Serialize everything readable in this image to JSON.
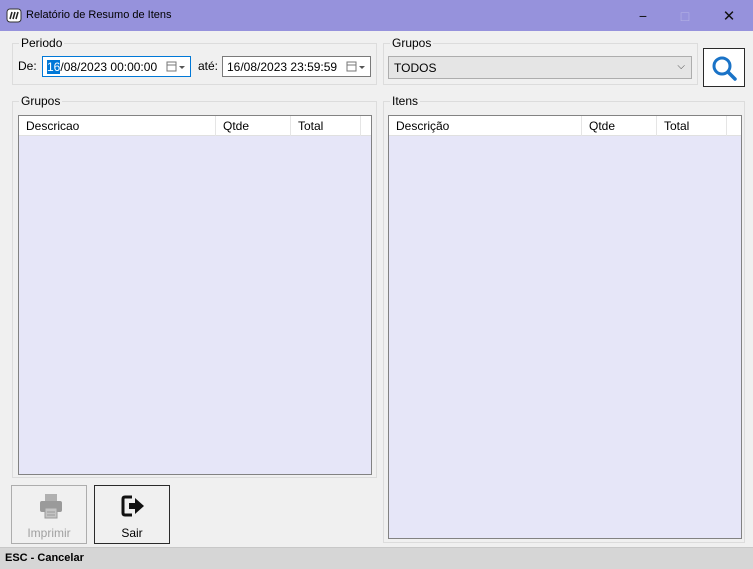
{
  "window": {
    "title": "Relatório de Resumo de Itens",
    "minimize_glyph": "−",
    "maximize_glyph": "□",
    "close_glyph": "✕",
    "titlebar_color": "#9692dc"
  },
  "periodo": {
    "legend": "Periodo",
    "de_label": "De:",
    "de_value_selected": "16",
    "de_value_rest": "/08/2023 00:00:00",
    "ate_label": "até:",
    "ate_value": "16/08/2023 23:59:59"
  },
  "grupos_filter": {
    "legend": "Grupos",
    "selected": "TODOS",
    "dropdown_glyph": "⌵"
  },
  "grupos_list": {
    "legend": "Grupos",
    "columns": [
      "Descricao",
      "Qtde",
      "Total"
    ],
    "rows": []
  },
  "itens_list": {
    "legend": "Itens",
    "columns": [
      "Descrição",
      "Qtde",
      "Total"
    ],
    "rows": []
  },
  "buttons": {
    "print_label": "Imprimir",
    "exit_label": "Sair"
  },
  "statusbar": {
    "text": "ESC - Cancelar"
  },
  "colors": {
    "list_background": "#e6e6f8",
    "selection": "#0078d7",
    "search_icon": "#1a73c7"
  },
  "icons": {
    "app": "app-logo-icon",
    "calendar": "calendar-icon",
    "search": "magnifier-icon",
    "print": "printer-icon",
    "exit": "exit-arrow-icon"
  }
}
